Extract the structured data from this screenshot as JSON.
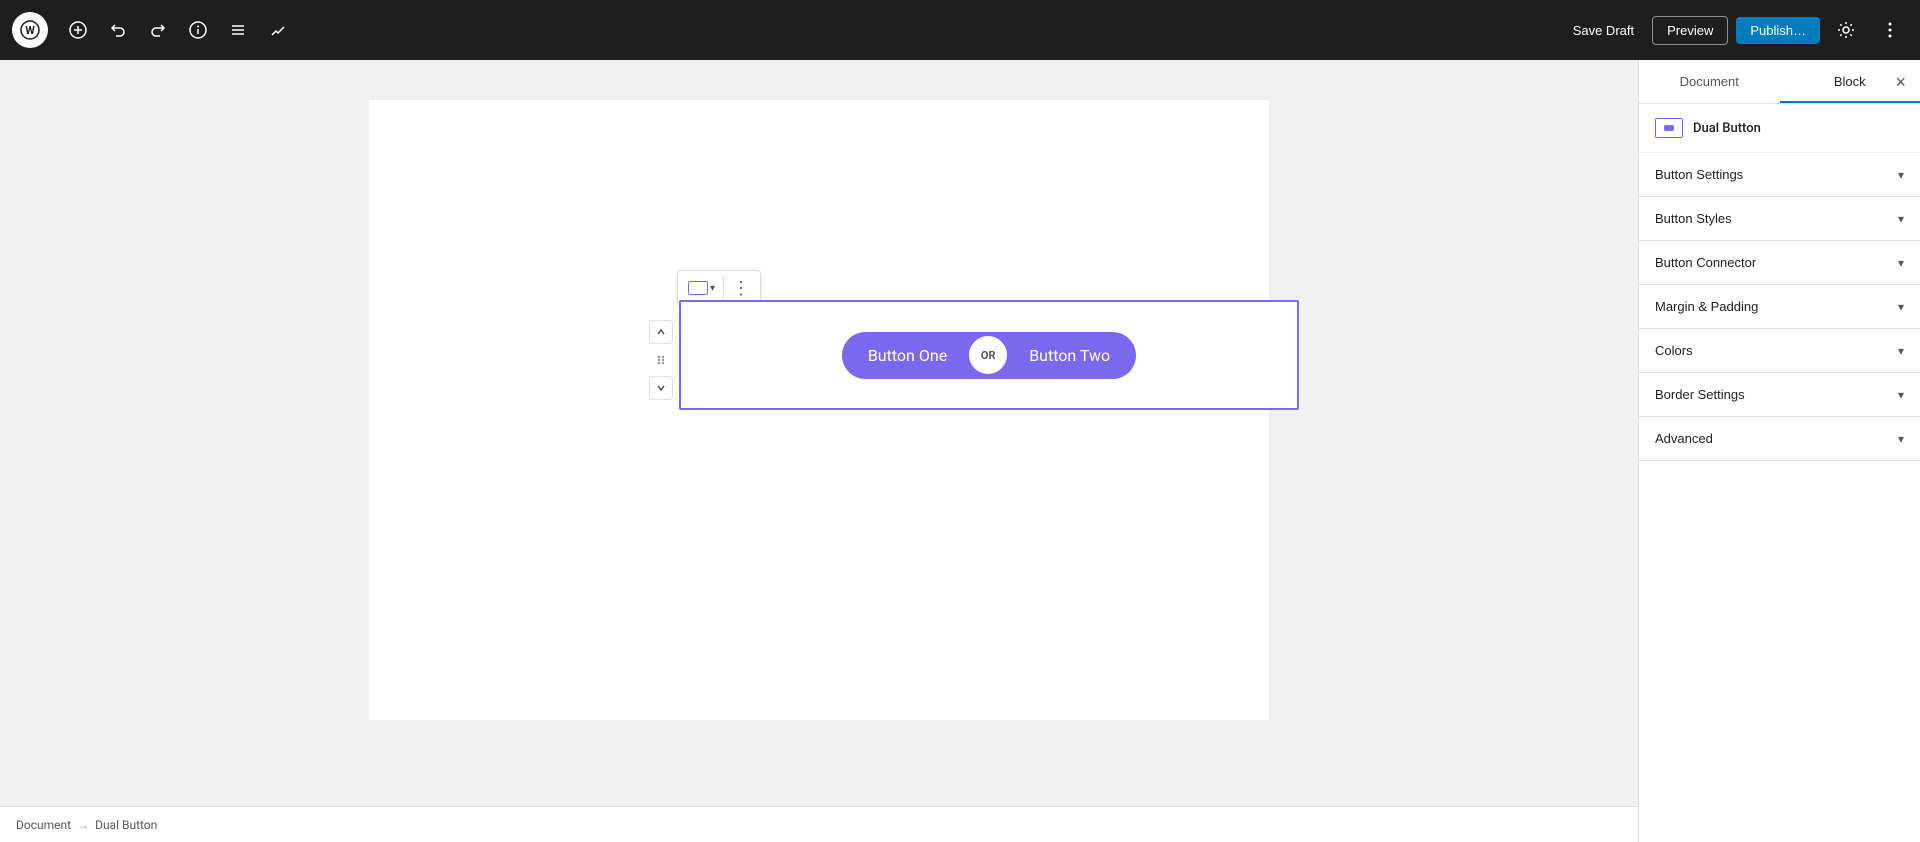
{
  "toolbar": {
    "add_label": "+",
    "undo_label": "↩",
    "redo_label": "↪",
    "info_label": "ℹ",
    "list_label": "≡",
    "edit_label": "✎",
    "save_draft_label": "Save Draft",
    "preview_label": "Preview",
    "publish_label": "Publish…",
    "settings_label": "⚙",
    "more_label": "⋮"
  },
  "panel": {
    "document_tab": "Document",
    "block_tab": "Block",
    "close_label": "×",
    "block_name": "Dual Button",
    "accordion_items": [
      {
        "label": "Button Settings"
      },
      {
        "label": "Button Styles"
      },
      {
        "label": "Button Connector"
      },
      {
        "label": "Margin & Padding"
      },
      {
        "label": "Colors"
      },
      {
        "label": "Border Settings"
      },
      {
        "label": "Advanced"
      }
    ]
  },
  "editor": {
    "button_one_text": "Button One",
    "button_two_text": "Button Two",
    "connector_text": "OR"
  },
  "breadcrumb": {
    "root": "Document",
    "separator": "→",
    "current": "Dual Button"
  }
}
